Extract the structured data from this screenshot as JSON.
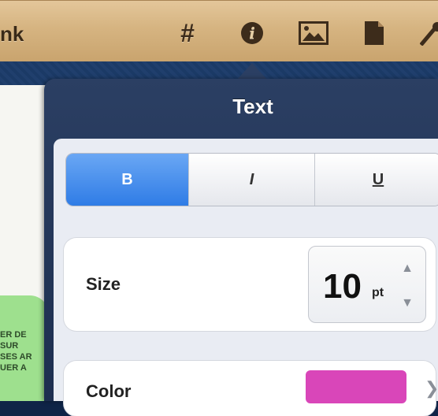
{
  "toolbar": {
    "title_fragment": "nk",
    "icons": [
      "hash-icon",
      "info-icon",
      "image-icon",
      "document-icon",
      "wrench-icon"
    ]
  },
  "popover": {
    "title": "Text",
    "style_buttons": [
      {
        "label": "B",
        "active": true
      },
      {
        "label": "I",
        "active": false
      },
      {
        "label": "U",
        "active": false
      }
    ],
    "size": {
      "label": "Size",
      "value": "10",
      "unit": "pt"
    },
    "color": {
      "label": "Color",
      "swatch": "#d946b9"
    }
  },
  "background": {
    "green_text": "ER DE\nSUR\nSES AR\nUER A"
  },
  "colors": {
    "toolbar_wood": "#d6b481",
    "popover_bg": "#1d2e4f",
    "segment_active": "#2f7ce6"
  }
}
